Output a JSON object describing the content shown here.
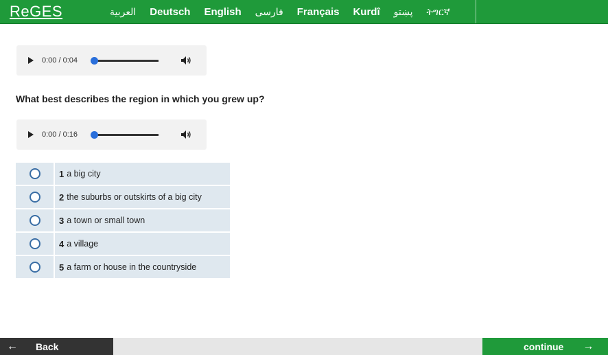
{
  "header": {
    "logo": "ReGES",
    "languages": [
      "العربية",
      "Deutsch",
      "English",
      "فارسی",
      "Français",
      "Kurdî",
      "پښتو",
      "ትግርኛ"
    ]
  },
  "audio_players": [
    {
      "time": "0:00 / 0:04",
      "progress": 0
    },
    {
      "time": "0:00 / 0:16",
      "progress": 0
    }
  ],
  "question": "What best describes the region in which you grew up?",
  "options": [
    {
      "num": "1",
      "text": "a big city"
    },
    {
      "num": "2",
      "text": "the suburbs or outskirts of a big city"
    },
    {
      "num": "3",
      "text": "a town or small town"
    },
    {
      "num": "4",
      "text": "a village"
    },
    {
      "num": "5",
      "text": "a farm or house in the countryside"
    }
  ],
  "nav": {
    "back_arrow": "←",
    "back_label": "Back",
    "continue_label": "continue",
    "continue_arrow": "→"
  },
  "colors": {
    "brand_green": "#1f9a3a",
    "option_bg": "#dfe8ef",
    "radio_border": "#3a6ea5",
    "slider_knob": "#2a6fdb"
  },
  "icons": [
    "play-icon",
    "volume-icon",
    "radio-unchecked",
    "arrow-left-icon",
    "arrow-right-icon"
  ]
}
